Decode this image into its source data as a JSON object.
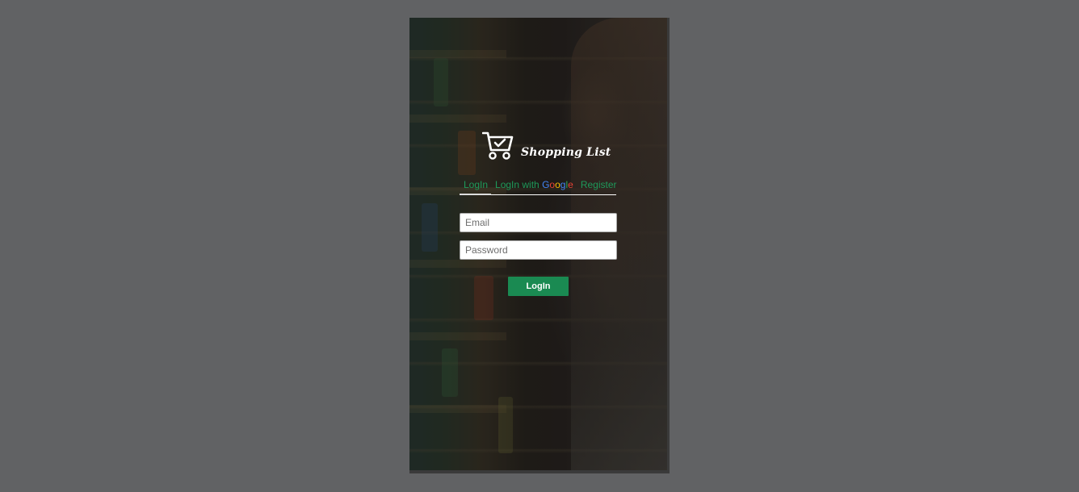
{
  "app": {
    "title": "Shopping List",
    "logo_icon": "shopping-cart-check-icon"
  },
  "tabs": [
    {
      "label": "LogIn",
      "active": true
    },
    {
      "label_prefix": "LogIn with ",
      "brand": [
        "G",
        "o",
        "o",
        "g",
        "l",
        "e"
      ],
      "active": false
    },
    {
      "label": "Register",
      "active": false
    }
  ],
  "form": {
    "email_placeholder": "Email",
    "email_value": "",
    "password_placeholder": "Password",
    "password_value": "",
    "submit_label": "LogIn"
  },
  "colors": {
    "page_background": "#616264",
    "accent_green": "#1a8a52",
    "tab_text": "#1e9a5a"
  }
}
